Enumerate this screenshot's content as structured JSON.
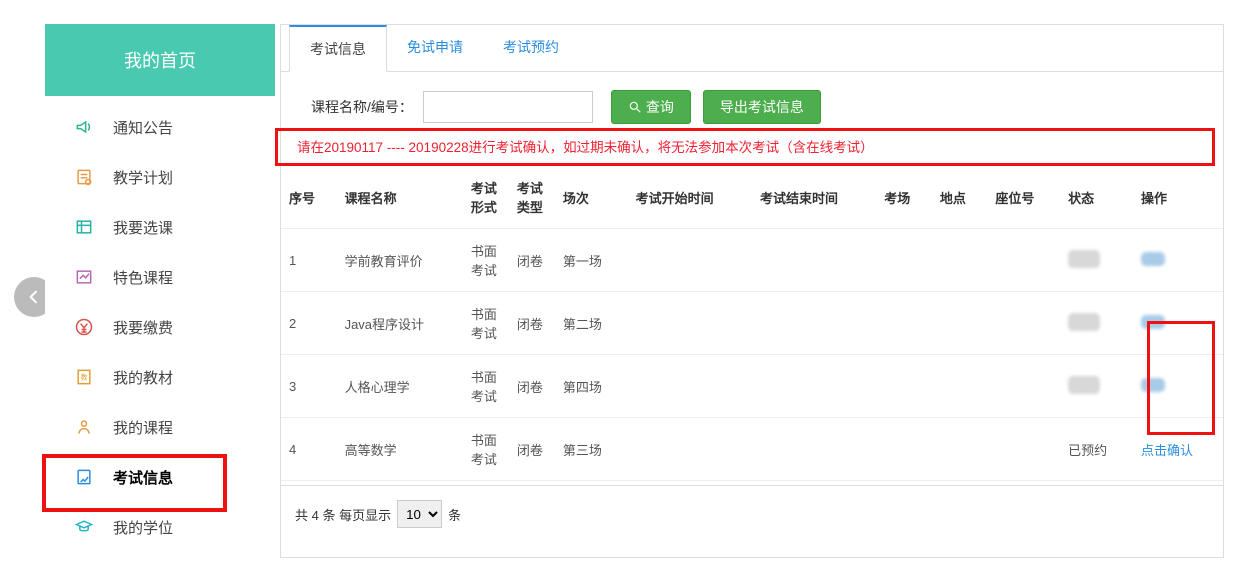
{
  "sidebar": {
    "home_title": "我的首页",
    "items": [
      {
        "label": "通知公告",
        "icon": "announce-icon",
        "color": "c-green"
      },
      {
        "label": "教学计划",
        "icon": "plan-icon",
        "color": "c-orange"
      },
      {
        "label": "我要选课",
        "icon": "select-course-icon",
        "color": "c-teal"
      },
      {
        "label": "特色课程",
        "icon": "featured-course-icon",
        "color": "c-purple"
      },
      {
        "label": "我要缴费",
        "icon": "pay-icon",
        "color": "c-red"
      },
      {
        "label": "我的教材",
        "icon": "textbook-icon",
        "color": "c-yellow"
      },
      {
        "label": "我的课程",
        "icon": "my-course-icon",
        "color": "c-orange"
      },
      {
        "label": "考试信息",
        "icon": "exam-info-icon",
        "color": "c-blue",
        "active": true
      },
      {
        "label": "我的学位",
        "icon": "degree-icon",
        "color": "c-cyan"
      }
    ]
  },
  "tabs": [
    {
      "label": "考试信息",
      "active": true
    },
    {
      "label": "免试申请"
    },
    {
      "label": "考试预约"
    }
  ],
  "filter": {
    "label": "课程名称/编号：",
    "value": "",
    "search_btn": "查询",
    "export_btn": "导出考试信息"
  },
  "warn": "请在20190117 ---- 20190228进行考试确认，如过期未确认，将无法参加本次考试（含在线考试）",
  "table": {
    "headers": [
      "序号",
      "课程名称",
      "考试形式",
      "考试类型",
      "场次",
      "考试开始时间",
      "考试结束时间",
      "考场",
      "地点",
      "座位号",
      "状态",
      "操作"
    ],
    "rows": [
      {
        "seq": "1",
        "course": "学前教育评价",
        "form": "书面考试",
        "type": "闭卷",
        "session": "第一场",
        "start": "",
        "end": "",
        "room": "",
        "place": "",
        "seat": "",
        "status": "",
        "action": ""
      },
      {
        "seq": "2",
        "course": "Java程序设计",
        "form": "书面考试",
        "type": "闭卷",
        "session": "第二场",
        "start": "",
        "end": "",
        "room": "",
        "place": "",
        "seat": "",
        "status": "",
        "action": ""
      },
      {
        "seq": "3",
        "course": "人格心理学",
        "form": "书面考试",
        "type": "闭卷",
        "session": "第四场",
        "start": "",
        "end": "",
        "room": "",
        "place": "",
        "seat": "",
        "status": "",
        "action": ""
      },
      {
        "seq": "4",
        "course": "高等数学",
        "form": "书面考试",
        "type": "闭卷",
        "session": "第三场",
        "start": "",
        "end": "",
        "room": "",
        "place": "",
        "seat": "",
        "status": "已预约",
        "action": "点击确认"
      }
    ]
  },
  "pager": {
    "prefix": "共 4 条 每页显示",
    "page_size": "10",
    "suffix": "条"
  }
}
